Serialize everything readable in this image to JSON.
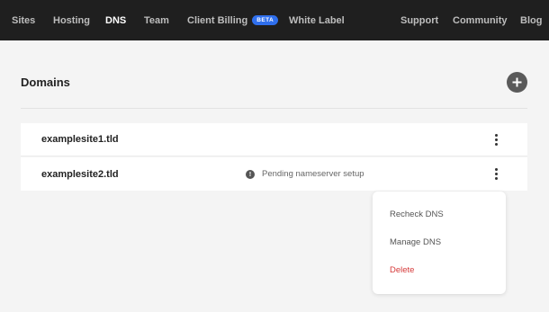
{
  "nav": {
    "left_items": [
      {
        "label": "Sites",
        "active": false
      },
      {
        "label": "Hosting",
        "active": false
      },
      {
        "label": "DNS",
        "active": true
      },
      {
        "label": "Team",
        "active": false
      },
      {
        "label": "Client Billing",
        "active": false,
        "badge": "BETA"
      },
      {
        "label": "White Label",
        "active": false
      }
    ],
    "right_items": [
      {
        "label": "Support"
      },
      {
        "label": "Community"
      },
      {
        "label": "Blog"
      }
    ]
  },
  "page": {
    "title": "Domains",
    "add_icon": "plus-icon"
  },
  "domains": [
    {
      "name": "examplesite1.tld",
      "status": ""
    },
    {
      "name": "examplesite2.tld",
      "status": "Pending nameserver setup",
      "status_icon": "exclamation-icon"
    }
  ],
  "context_menu": {
    "items": [
      {
        "label": "Recheck DNS",
        "danger": false
      },
      {
        "label": "Manage DNS",
        "danger": false
      },
      {
        "label": "Delete",
        "danger": true
      }
    ]
  },
  "colors": {
    "nav_bg": "#1f1f1f",
    "page_bg": "#f4f4f4",
    "badge": "#2f6fed",
    "danger": "#d63a3a"
  }
}
